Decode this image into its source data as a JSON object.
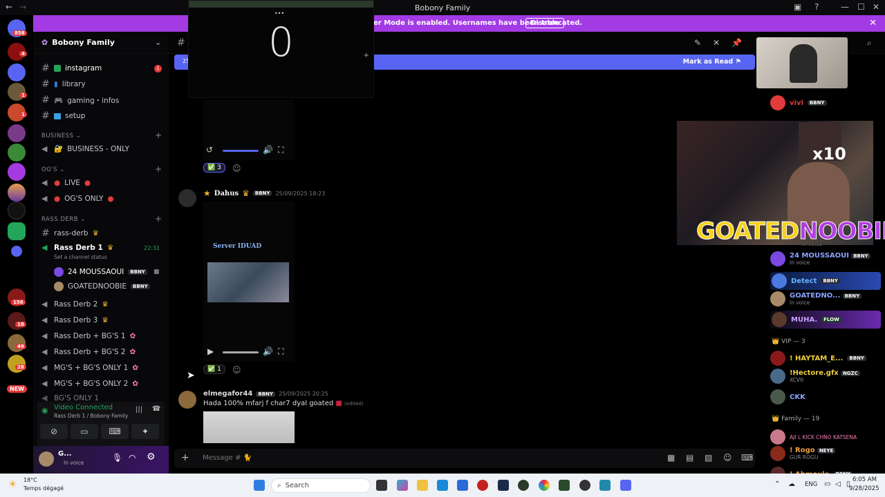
{
  "window": {
    "title": "Bobony Family",
    "min": "—",
    "max": "☐",
    "close": "✕"
  },
  "banner": {
    "text": "er Mode is enabled. Usernames have been truncated.",
    "button": "Disable",
    "close": "✕"
  },
  "rail": {
    "badges": [
      "858",
      "4",
      "1",
      "1",
      "2",
      "4",
      "1",
      "156",
      "18",
      "49",
      "28"
    ],
    "new_label": "NEW"
  },
  "server": {
    "name": "Bobony Family"
  },
  "channels": {
    "instagram": "instagram",
    "library": "library",
    "gaming": "gaming・infos",
    "setup": "setup",
    "cat_business": "BUSINESS",
    "business_only": "BUSINESS - ONLY",
    "cat_ogs": "OG'S",
    "live": "LIVE",
    "ogs_only": "OG'S ONLY",
    "cat_rass": "RASS DERB",
    "rass_derb": "rass-derb",
    "rass1": "Rass Derb 1",
    "rass1_time": "22:31",
    "rass1_status": "Set a channel status",
    "voice_user1": "24 MOUSSAOUI",
    "voice_user2": "GOATEDNOOBIE",
    "rass2": "Rass Derb 2",
    "rass3": "Rass Derb 3",
    "rassbg1": "Rass Derb + BG'S 1",
    "rassbg2": "Rass Derb + BG'S 2",
    "mgbg1": "MG'S + BG'S ONLY 1",
    "mgbg2": "MG'S + BG'S ONLY 2",
    "bgonly": "BG'S ONLY 1",
    "instagram_unread": "1"
  },
  "tags": {
    "bbny": "BBNY",
    "flow": "FLOW",
    "ngzc": "NGZC",
    "neye": "NEYE"
  },
  "voice": {
    "status": "Video Connected",
    "location": "Rass Derb 1 / Bobony Family"
  },
  "user": {
    "name": "G...",
    "status": "In voice"
  },
  "main": {
    "unread_date": "25",
    "mark_read": "Mark as Read",
    "counter": "0",
    "reaction1_count": "3",
    "msg2_name": "Dahus",
    "msg2_time": "25/09/2025 18:23",
    "video_title": "Server IDUAD",
    "reaction2_count": "1",
    "msg3_name": "elmegafor44",
    "msg3_time": "25/09/2025 20:25",
    "msg3_text": "Hada 100% mfarj f char7  dyal goated",
    "msg3_edited": "(edited)",
    "composer_placeholder": "Message #"
  },
  "members": {
    "vivi": "vivi",
    "m24": "24 MOUSSAOUI",
    "m24_sub": "In voice",
    "detect": "Detect",
    "goated": "GOATEDNO...",
    "goated_sub": "In voice",
    "muha": "MUHA.",
    "vip_group": "VIP — 3",
    "haytam": "! HAYTAM_E...",
    "hectore": "!Hectore.gfx",
    "hectore_sub": "XCVII:",
    "ckk": "CKK",
    "family_group": "Family — 19",
    "aji": "AJI L KICK CHNO KATSENA",
    "rogo": "! Rogo",
    "rogo_sub": "GUR ROGU",
    "abmoula": "! Abmoula",
    "in_voice_top": "in voice"
  },
  "stream_overlay": {
    "logo_part1": "GOATED",
    "logo_part2": "NOOBIE",
    "multiplier": "x10"
  },
  "taskbar": {
    "weather_temp": "18°C",
    "weather_desc": "Temps dégagé",
    "search": "Search",
    "lang": "ENG",
    "time": "6:05 AM",
    "date": "9/28/2025"
  }
}
